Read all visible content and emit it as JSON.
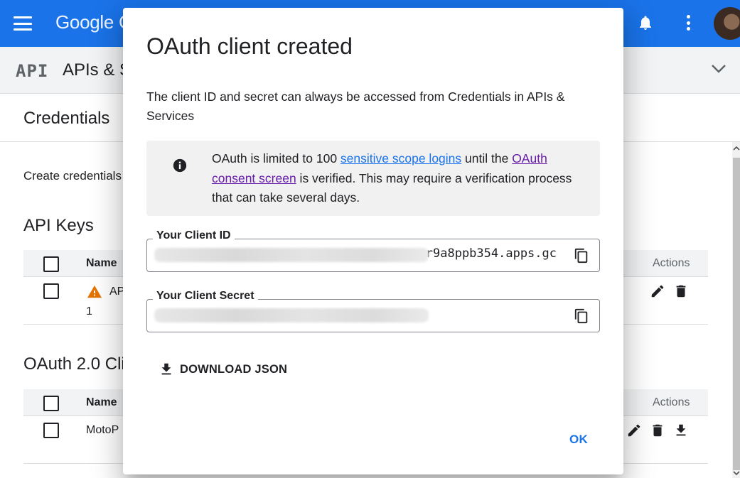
{
  "header": {
    "product_logo": "Google C",
    "icons": {
      "menu": "menu-icon",
      "notifications": "bell-icon",
      "more": "more-vert-icon",
      "account": "avatar"
    }
  },
  "subheader": {
    "api_badge": "API",
    "title": "APIs & S"
  },
  "page": {
    "title": "Credentials",
    "create_text": "Create credentials",
    "api_keys": {
      "section_title": "API Keys",
      "header_name": "Name",
      "header_actions": "Actions",
      "rows": [
        {
          "name": "AP",
          "name_line2": "1",
          "warning": true
        }
      ]
    },
    "oauth_clients": {
      "section_title": "OAuth 2.0 Cli",
      "header_name": "Name",
      "header_actions": "Actions",
      "rows": [
        {
          "name": "MotoP"
        }
      ]
    }
  },
  "dialog": {
    "title": "OAuth client created",
    "description": "The client ID and secret can always be accessed from Credentials in APIs & Services",
    "info": {
      "text_before": "OAuth is limited to 100 ",
      "link1": "sensitive scope logins",
      "text_middle": " until the ",
      "link2": "OAuth consent screen",
      "text_after": " is verified. This may require a verification process that can take several days."
    },
    "client_id": {
      "label": "Your Client ID",
      "value_visible": "r9a8ppb354.apps.gc"
    },
    "client_secret": {
      "label": "Your Client Secret",
      "value_visible": ""
    },
    "download_label": "DOWNLOAD JSON",
    "ok_label": "OK"
  },
  "colors": {
    "brand_blue": "#1a73e8",
    "link_visited": "#681da8",
    "warning": "#e37400"
  }
}
